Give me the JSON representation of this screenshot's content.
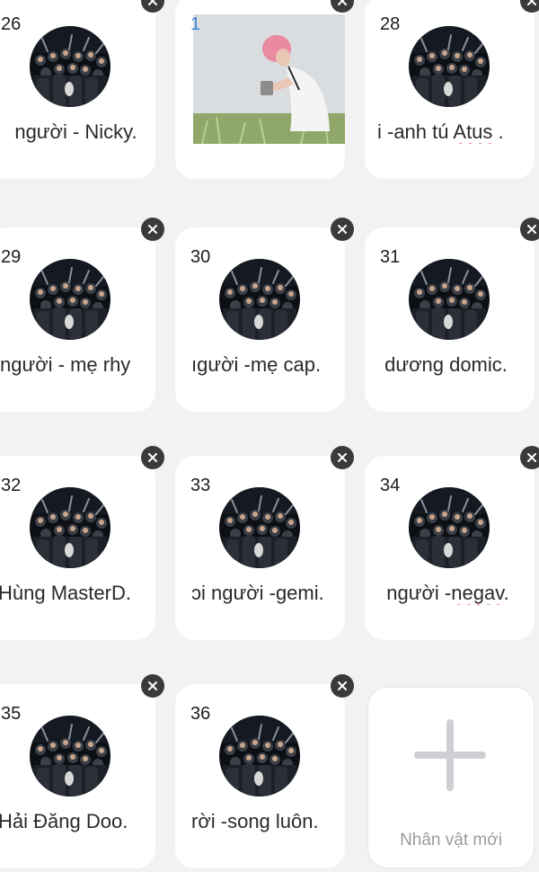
{
  "cards": [
    {
      "number": "26",
      "name": "người - Nicky."
    },
    {
      "number": "1"
    },
    {
      "number": "28",
      "name_prefix": "i -anh tú ",
      "name_spell": "Atus",
      "name_suffix": " ."
    },
    {
      "number": "29",
      "name": "người - mẹ rhy"
    },
    {
      "number": "30",
      "name": "ıgười -mẹ cap."
    },
    {
      "number": "31",
      "name": "dương domic."
    },
    {
      "number": "32",
      "name": "Hùng MasterD."
    },
    {
      "number": "33",
      "name": "ɔi người -gemi."
    },
    {
      "number": "34",
      "name_prefix": "người -",
      "name_spell": "negav",
      "name_suffix": "."
    },
    {
      "number": "35",
      "name": "Hải Đăng Doo."
    },
    {
      "number": "36",
      "name": "rời -song luôn."
    }
  ],
  "add_card": {
    "label": "Nhân vật mới",
    "icon": "plus-icon"
  },
  "icons": {
    "remove": "close-icon",
    "avatar": "concert-crowd-avatar"
  },
  "colors": {
    "background": "#f2f2f4",
    "card": "#ffffff",
    "close_button": "#3a3a3c",
    "spell_underline": "#e0434d",
    "number_accent": "#3b82d8"
  }
}
